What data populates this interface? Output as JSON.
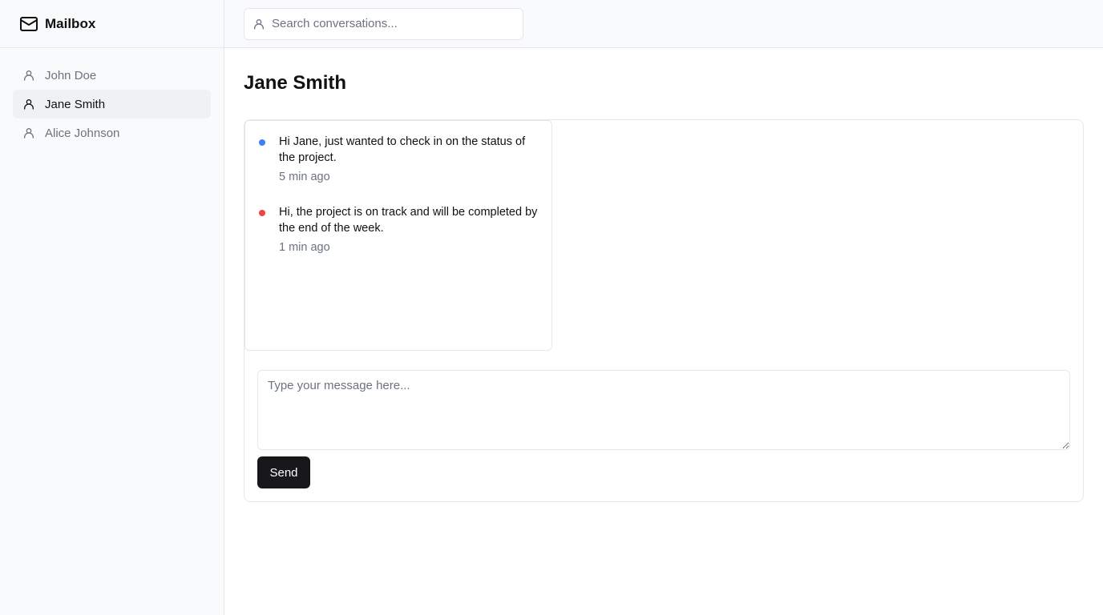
{
  "app": {
    "title": "Mailbox",
    "icon": "mail-icon"
  },
  "sidebar": {
    "contacts": [
      {
        "name": "John Doe",
        "icon": "user-icon",
        "active": false
      },
      {
        "name": "Jane Smith",
        "icon": "user-icon",
        "active": true
      },
      {
        "name": "Alice Johnson",
        "icon": "user-icon",
        "active": false
      }
    ]
  },
  "search": {
    "placeholder": "Search conversations...",
    "icon": "user-icon"
  },
  "conversation": {
    "title": "Jane Smith",
    "messages": [
      {
        "text": "Hi Jane, just wanted to check in on the status of the project.",
        "time": "5 min ago",
        "dot_color": "#3b82f6"
      },
      {
        "text": "Hi, the project is on track and will be completed by the end of the week.",
        "time": "1 min ago",
        "dot_color": "#ef4444"
      }
    ]
  },
  "composer": {
    "placeholder": "Type your message here...",
    "send_label": "Send"
  },
  "colors": {
    "accent_button": "#18181b",
    "sidebar_bg": "#f9fafb",
    "active_item_bg": "#f0f1f3"
  }
}
